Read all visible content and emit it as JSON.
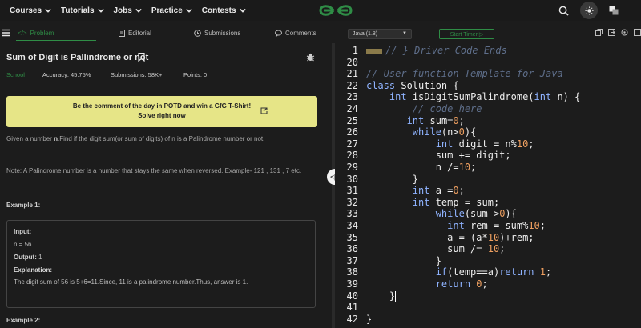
{
  "nav": {
    "items": [
      "Courses",
      "Tutorials",
      "Jobs",
      "Practice",
      "Contests"
    ],
    "logo": "gfg-logo"
  },
  "left_tabs": [
    {
      "label": "Problem",
      "icon": "code-icon"
    },
    {
      "label": "Editorial",
      "icon": "document-icon"
    },
    {
      "label": "Submissions",
      "icon": "clock-icon"
    },
    {
      "label": "Comments",
      "icon": "comment-icon"
    }
  ],
  "problem": {
    "title": "Sum of Digit is Pallindrome or not",
    "difficulty": "School",
    "accuracy": "Accuracy: 45.75%",
    "submissions": "Submissions: 58K+",
    "points": "Points: 0",
    "banner_line1": "Be the comment of the day in POTD and win a GfG T-Shirt!",
    "banner_line2": "Solve right now",
    "desc_pre": "Given a number ",
    "desc_bold": "n",
    "desc_post": ".Find if the digit sum(or sum of digits) of n is a Palindrome number or not.",
    "note": "Note: A Palindrome number is a number that stays the same when reversed. Example- 121 , 131 , 7 etc.",
    "example1_head": "Example 1:",
    "example1": {
      "input_label": "Input:",
      "input_value": "n = 56",
      "output_label": "Output:",
      "output_value": "1",
      "explanation_label": "Explanation:",
      "explanation_value": "The digit sum of 56 is 5+6=11.Since, 11 is a palindrome number.Thus, answer is 1."
    },
    "example2_head": "Example 2:"
  },
  "editor": {
    "language": "Java (1.8)",
    "timer_label": "Start Timer",
    "lines": [
      {
        "n": "1",
        "html": "<span class=\"fold-mark\"></span><span class=\"cm\">// } Driver Code Ends</span>"
      },
      {
        "n": "20",
        "html": ""
      },
      {
        "n": "21",
        "html": "<span class=\"cm\">// User function Template for Java</span>"
      },
      {
        "n": "22",
        "html": "<span class=\"kw\">class</span> Solution {"
      },
      {
        "n": "23",
        "html": "    <span class=\"kw\">int</span> isDigitSumPalindrome(<span class=\"kw\">int</span> n) {"
      },
      {
        "n": "24",
        "html": "        <span class=\"cm\">// code here</span>"
      },
      {
        "n": "25",
        "html": "       <span class=\"kw\">int</span> sum=<span class=\"num\">0</span>;"
      },
      {
        "n": "26",
        "html": "        <span class=\"kw\">while</span>(n&gt;<span class=\"num\">0</span>){"
      },
      {
        "n": "27",
        "html": "            <span class=\"kw\">int</span> digit = n%<span class=\"num\">10</span>;"
      },
      {
        "n": "28",
        "html": "            sum += digit;"
      },
      {
        "n": "29",
        "html": "            n /=<span class=\"num\">10</span>;"
      },
      {
        "n": "30",
        "html": "        }"
      },
      {
        "n": "31",
        "html": "        <span class=\"kw\">int</span> a =<span class=\"num\">0</span>;"
      },
      {
        "n": "32",
        "html": "        <span class=\"kw\">int</span> temp = sum;"
      },
      {
        "n": "33",
        "html": "            <span class=\"kw\">while</span>(sum &gt;<span class=\"num\">0</span>){"
      },
      {
        "n": "34",
        "html": "              <span class=\"kw\">int</span> rem = sum%<span class=\"num\">10</span>;"
      },
      {
        "n": "35",
        "html": "              a = (a*<span class=\"num\">10</span>)+rem;"
      },
      {
        "n": "36",
        "html": "              sum /= <span class=\"num\">10</span>;"
      },
      {
        "n": "37",
        "html": "            }"
      },
      {
        "n": "38",
        "html": "            <span class=\"kw\">if</span>(temp==a)<span class=\"kw\">return</span> <span class=\"num\">1</span>;"
      },
      {
        "n": "39",
        "html": "            <span class=\"kw\">return</span> <span class=\"num\">0</span>;"
      },
      {
        "n": "40",
        "html": "    }<span class=\"cursor\"></span>"
      },
      {
        "n": "41",
        "html": ""
      },
      {
        "n": "42",
        "html": "}"
      }
    ]
  },
  "colors": {
    "accent_green": "#2f8d46",
    "banner_yellow": "#e6e587",
    "keyword": "#8fb3ff",
    "comment": "#5e6e8a",
    "number": "#f0a060"
  }
}
